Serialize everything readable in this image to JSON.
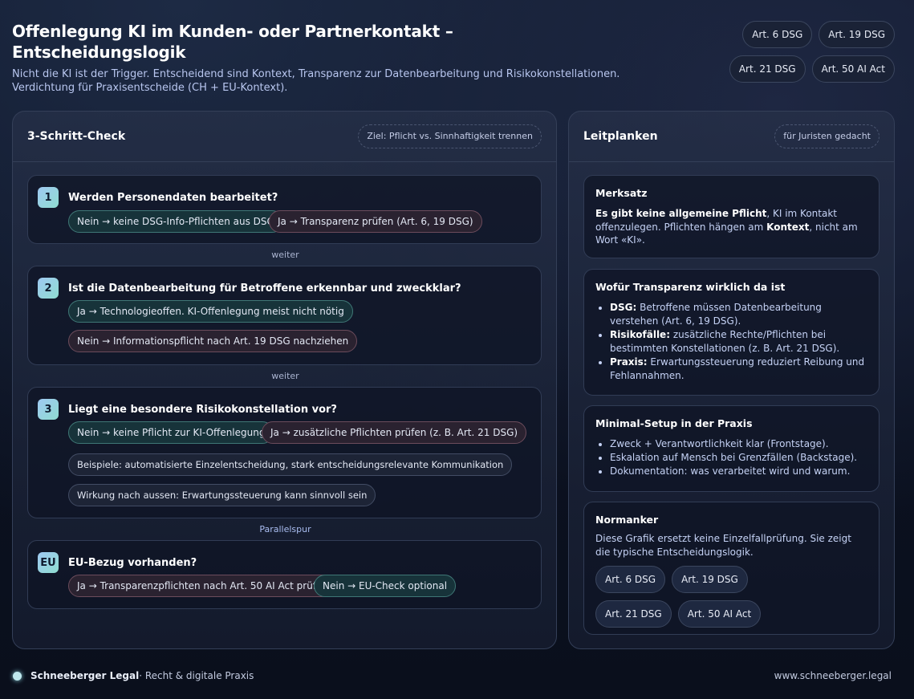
{
  "header": {
    "title": "Offenlegung KI im Kunden- oder Partnerkontakt – Entscheidungslogik",
    "subtitle_line1": "Nicht die KI ist der Trigger. Entscheidend sind Kontext, Transparenz zur Datenbearbeitung und Risikokonstellationen.",
    "subtitle_line2": "Verdichtung für Praxisentscheide (CH + EU-Kontext).",
    "badges": [
      "Art. 6 DSG",
      "Art. 19 DSG",
      "Art. 21 DSG",
      "Art. 50 AI Act"
    ]
  },
  "left": {
    "title": "3-Schritt-Check",
    "goal": "Ziel: Pflicht vs. Sinnhaftigkeit trennen",
    "steps": [
      {
        "num": "1",
        "question": "Werden Personendaten bearbeitet?",
        "chips": [
          "Nein → keine DSG-Info-Pflichten aus DSG",
          "Ja → Transparenz prüfen (Art. 6, 19 DSG)"
        ]
      },
      {
        "num": "2",
        "question": "Ist die Datenbearbeitung für Betroffene erkennbar und zweckklar?",
        "chips": [
          "Ja → Technologieoffen. KI-Offenlegung meist nicht nötig",
          "Nein → Informationspflicht nach Art. 19 DSG nachziehen"
        ]
      },
      {
        "num": "3",
        "question": "Liegt eine besondere Risikokonstellation vor?",
        "chips": [
          "Nein → keine Pflicht zur KI-Offenlegung",
          "Ja → zusätzliche Pflichten prüfen (z. B. Art. 21 DSG)",
          "Beispiele: automatisierte Einzelentscheidung, stark entscheidungsrelevante Kommunikation",
          "Wirkung nach aussen: Erwartungssteuerung kann sinnvoll sein"
        ]
      },
      {
        "num": "EU",
        "question": "EU-Bezug vorhanden?",
        "chips": [
          "Ja → Transparenzpflichten nach Art. 50 AI Act prüfen",
          "Nein → EU-Check optional"
        ]
      }
    ],
    "connectors": [
      "weiter",
      "weiter",
      "Parallelspur"
    ]
  },
  "right": {
    "title": "Leitplanken",
    "tag": "für Juristen gedacht",
    "merksatz": {
      "title": "Merksatz",
      "bold1": "Es gibt keine allgemeine Pflicht",
      "text1": ", KI im Kontakt offenzulegen. Pflichten hängen am ",
      "bold2": "Kontext",
      "text2": ", nicht am Wort «KI»."
    },
    "transparenz": {
      "title": "Wofür Transparenz wirklich da ist",
      "items": [
        {
          "label": "DSG:",
          "text": " Betroffene müssen Datenbearbeitung verstehen (Art. 6, 19 DSG)."
        },
        {
          "label": "Risikofälle:",
          "text": " zusätzliche Rechte/Pflichten bei bestimmten Konstellationen (z. B. Art. 21 DSG)."
        },
        {
          "label": "Praxis:",
          "text": " Erwartungssteuerung reduziert Reibung und Fehlannahmen."
        }
      ]
    },
    "setup": {
      "title": "Minimal-Setup in der Praxis",
      "items": [
        "Zweck + Verantwortlichkeit klar (Frontstage).",
        "Eskalation auf Mensch bei Grenzfällen (Backstage).",
        "Dokumentation: was verarbeitet wird und warum."
      ]
    },
    "normanker": {
      "title": "Normanker",
      "text": "Diese Grafik ersetzt keine Einzelfallprüfung. Sie zeigt die typische Entscheidungslogik.",
      "badges": [
        "Art. 6 DSG",
        "Art. 19 DSG",
        "Art. 21 DSG",
        "Art. 50 AI Act"
      ]
    }
  },
  "footer": {
    "brand": "Schneeberger Legal",
    "tagline": " · Recht & digitale Praxis",
    "url": "www.schneeberger.legal"
  }
}
